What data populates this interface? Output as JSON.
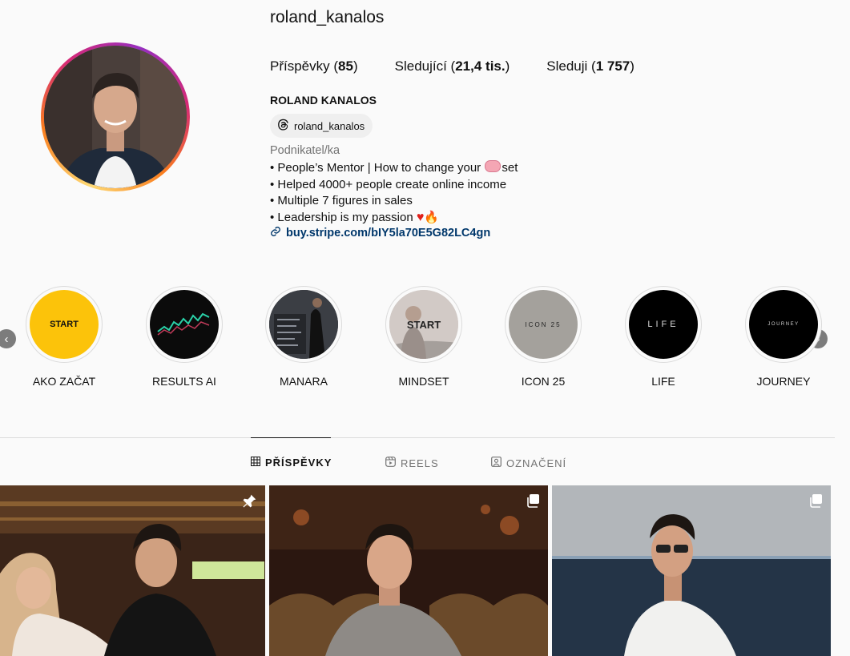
{
  "profile": {
    "username": "roland_kanalos",
    "stats": {
      "posts_label": "Příspěvky",
      "posts_value": "85",
      "followers_label": "Sledující",
      "followers_value": "21,4 tis.",
      "following_label": "Sleduji",
      "following_value": "1 757"
    },
    "full_name": "ROLAND KANALOS",
    "threads_handle": "roland_kanalos",
    "category": "Podnikatel/ka",
    "bio": {
      "line1_before": "• People’s Mentor | How to change your ",
      "line1_after": "set",
      "line2": "• Helped 4000+ people create online income",
      "line3": "• Multiple 7 figures in sales",
      "line4": "• Leadership is my passion "
    },
    "link": "buy.stripe.com/bIY5la70E5G82LC4gn"
  },
  "highlights": [
    {
      "label": "AKO ZAČAT",
      "cover_text": "START"
    },
    {
      "label": "RESULTS AI",
      "cover_text": ""
    },
    {
      "label": "MANARA",
      "cover_text": ""
    },
    {
      "label": "MINDSET",
      "cover_text": "START"
    },
    {
      "label": "ICON 25",
      "cover_text": "ICON 25"
    },
    {
      "label": "LIFE",
      "cover_text": "LIFE"
    },
    {
      "label": "JOURNEY",
      "cover_text": "JOURNEY"
    }
  ],
  "tabs": {
    "posts": "PŘÍSPĚVKY",
    "reels": "REELS",
    "tagged": "OZNAČENÍ"
  },
  "colors": {
    "link": "#00376b",
    "secondary_text": "#737373",
    "highlight_start_bg": "#fcc30a"
  },
  "icons": {
    "prev": "chevron-left-icon",
    "next": "chevron-right-icon",
    "threads": "threads-icon",
    "link": "link-icon",
    "posts_tab": "grid-icon",
    "reels_tab": "reels-icon",
    "tagged_tab": "tagged-icon",
    "pinned": "pin-icon",
    "carousel": "carousel-icon"
  }
}
